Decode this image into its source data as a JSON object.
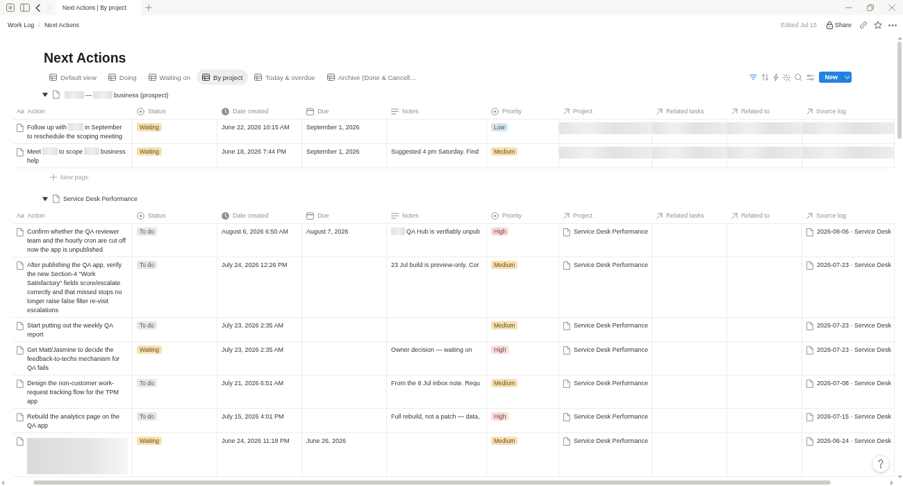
{
  "browser": {
    "tab_title": "Next Actions | By project",
    "nav": [
      {
        "kind": "back",
        "disabled": false
      },
      {
        "kind": "forward",
        "disabled": true
      }
    ]
  },
  "breadcrumb": {
    "separator": "/",
    "items": [
      "Work Log",
      "Next Actions"
    ]
  },
  "header": {
    "edited": "Edited Jul 15",
    "share": "Share"
  },
  "title": "Next Actions",
  "views": [
    {
      "label": "Default view",
      "selected": false
    },
    {
      "label": "Doing",
      "selected": false
    },
    {
      "label": "Waiting on",
      "selected": false
    },
    {
      "label": "By project",
      "selected": true
    },
    {
      "label": "Today & overdue",
      "selected": false
    },
    {
      "label": "Archive (Done & Cancell…",
      "selected": false
    }
  ],
  "toolbar": {
    "filter_active": true,
    "new_label": "New"
  },
  "groups": [
    {
      "expanded": true,
      "title": [
        {
          "kind": "redacted"
        },
        {
          "kind": "text",
          "text": "—"
        },
        {
          "kind": "redacted"
        },
        {
          "kind": "text",
          "text": "business (prospect)"
        }
      ],
      "columns": [
        {
          "label": "Action",
          "kind": "title",
          "glyph": "Aa"
        },
        {
          "label": "Status",
          "kind": "status"
        },
        {
          "label": "Date created",
          "kind": "created_time"
        },
        {
          "label": "Due",
          "kind": "date"
        },
        {
          "label": "Notes",
          "kind": "text"
        },
        {
          "label": "Priority",
          "kind": "select"
        },
        {
          "label": "Project",
          "kind": "relation"
        },
        {
          "label": "Related tasks",
          "kind": "relation"
        },
        {
          "label": "Related to",
          "kind": "relation"
        },
        {
          "label": "Source log",
          "kind": "relation"
        }
      ],
      "rows": [
        {
          "action": [
            {
              "kind": "text",
              "text": "Follow up with"
            },
            {
              "kind": "redacted"
            },
            {
              "kind": "text",
              "text": "in September to reschedule the scoping meeting"
            }
          ],
          "status": {
            "text": "Waiting",
            "color": "#f6e1b3"
          },
          "date_created": "June 22, 2026 10:15 AM",
          "due": "September 1, 2026",
          "priority": {
            "text": "Low",
            "color": "#d3e5f0"
          },
          "project": {
            "kind": "redacted"
          },
          "related_tasks": {
            "kind": "redacted"
          },
          "related_to": {
            "kind": "redacted"
          },
          "source_log": {
            "kind": "redacted"
          }
        },
        {
          "action": [
            {
              "kind": "text",
              "text": "Meet"
            },
            {
              "kind": "redacted"
            },
            {
              "kind": "text",
              "text": "to scope"
            },
            {
              "kind": "redacted"
            },
            {
              "kind": "text",
              "text": "business help"
            }
          ],
          "status": {
            "text": "Waiting",
            "color": "#f6e1b3"
          },
          "date_created": "June 18, 2026 7:44 PM",
          "due": "September 1, 2026",
          "notes": [
            {
              "kind": "text",
              "text": "Suggested 4 pm Saturday. Find"
            }
          ],
          "priority": {
            "text": "Medium",
            "color": "#f6e1b3"
          },
          "project": {
            "kind": "redacted"
          },
          "related_tasks": {
            "kind": "redacted"
          },
          "related_to": {
            "kind": "redacted"
          },
          "source_log": {
            "kind": "redacted"
          }
        }
      ],
      "new_page": "New page"
    },
    {
      "expanded": true,
      "title": [
        {
          "kind": "text",
          "text": "Service Desk Performance"
        }
      ],
      "columns": [
        {
          "label": "Action",
          "kind": "title",
          "glyph": "Aa"
        },
        {
          "label": "Status",
          "kind": "status"
        },
        {
          "label": "Date created",
          "kind": "created_time"
        },
        {
          "label": "Due",
          "kind": "date"
        },
        {
          "label": "Notes",
          "kind": "text"
        },
        {
          "label": "Priority",
          "kind": "select"
        },
        {
          "label": "Project",
          "kind": "relation"
        },
        {
          "label": "Related tasks",
          "kind": "relation"
        },
        {
          "label": "Related to",
          "kind": "relation"
        },
        {
          "label": "Source log",
          "kind": "relation"
        }
      ],
      "rows": [
        {
          "action": [
            {
              "kind": "text",
              "text": "Confirm whether the QA reviewer team and the hourly cron are cut off now the app is unpublished"
            }
          ],
          "status": {
            "text": "To do",
            "color": "#e8e7e4"
          },
          "date_created": "August 6, 2026 6:50 AM",
          "due": "August 7, 2026",
          "notes": [
            {
              "kind": "redacted"
            },
            {
              "kind": "text",
              "text": "QA Hub is verifiably unpub"
            }
          ],
          "priority": {
            "text": "High",
            "color": "#f9dcd8"
          },
          "project": {
            "kind": "page",
            "text": "Service Desk Performance"
          },
          "source_log": {
            "kind": "page",
            "text": "2026-08-06 · Service Desk"
          }
        },
        {
          "action": [
            {
              "kind": "text",
              "text": "After publishing the QA app, verify the new Section-4 \"Work Satisfactory\" fields score/escalate correctly and that missed stops no longer raise false filter re-visit escalations"
            }
          ],
          "status": {
            "text": "To do",
            "color": "#e8e7e4"
          },
          "date_created": "July 24, 2026 12:26 PM",
          "notes": [
            {
              "kind": "text",
              "text": "23 Jul build is preview-only. Cor"
            }
          ],
          "priority": {
            "text": "Medium",
            "color": "#f6e1b3"
          },
          "project": {
            "kind": "page",
            "text": "Service Desk Performance"
          },
          "source_log": {
            "kind": "page",
            "text": "2026-07-23 · Service Desk"
          }
        },
        {
          "action": [
            {
              "kind": "text",
              "text": "Start putting out the weekly QA report"
            }
          ],
          "status": {
            "text": "To do",
            "color": "#e8e7e4"
          },
          "date_created": "July 23, 2026 2:35 AM",
          "priority": {
            "text": "Medium",
            "color": "#f6e1b3"
          },
          "project": {
            "kind": "page",
            "text": "Service Desk Performance"
          },
          "source_log": {
            "kind": "page",
            "text": "2026-07-23 · Service Desk"
          }
        },
        {
          "action": [
            {
              "kind": "text",
              "text": "Get Matt/Jasmine to decide the feedback-to-techs mechanism for QA fails"
            }
          ],
          "status": {
            "text": "Waiting",
            "color": "#f6e1b3"
          },
          "date_created": "July 23, 2026 2:35 AM",
          "notes": [
            {
              "kind": "text",
              "text": "Owner decision — waiting on"
            }
          ],
          "priority": {
            "text": "High",
            "color": "#f9dcd8"
          },
          "project": {
            "kind": "page",
            "text": "Service Desk Performance"
          },
          "source_log": {
            "kind": "page",
            "text": "2026-07-23 · Service Desk"
          }
        },
        {
          "action": [
            {
              "kind": "text",
              "text": "Design the non-customer work-request tracking flow for the TPM app"
            }
          ],
          "status": {
            "text": "To do",
            "color": "#e8e7e4"
          },
          "date_created": "July 21, 2026 6:51 AM",
          "notes": [
            {
              "kind": "text",
              "text": "From the 8 Jul inbox note. Requ"
            }
          ],
          "priority": {
            "text": "Medium",
            "color": "#f6e1b3"
          },
          "project": {
            "kind": "page",
            "text": "Service Desk Performance"
          },
          "source_log": {
            "kind": "page",
            "text": "2026-07-08 · Service Desk"
          }
        },
        {
          "action": [
            {
              "kind": "text",
              "text": "Rebuild the analytics page on the QA app"
            }
          ],
          "status": {
            "text": "To do",
            "color": "#e8e7e4"
          },
          "date_created": "July 15, 2026 4:01 PM",
          "notes": [
            {
              "kind": "text",
              "text": "Full rebuild, not a patch — data,"
            }
          ],
          "priority": {
            "text": "High",
            "color": "#f9dcd8"
          },
          "project": {
            "kind": "page",
            "text": "Service Desk Performance"
          },
          "source_log": {
            "kind": "page",
            "text": "2026-07-15 · Service Desk"
          }
        },
        {
          "action": [
            {
              "kind": "redacted_block"
            }
          ],
          "status": {
            "text": "Waiting",
            "color": "#f6e1b3"
          },
          "date_created": "June 24, 2026 11:18 PM",
          "due": "June 26, 2026",
          "priority": {
            "text": "Medium",
            "color": "#f6e1b3"
          },
          "project": {
            "kind": "page",
            "text": "Service Desk Performance"
          },
          "source_log": {
            "kind": "page",
            "text": "2026-06-24 · Service Desk"
          }
        }
      ]
    }
  ]
}
